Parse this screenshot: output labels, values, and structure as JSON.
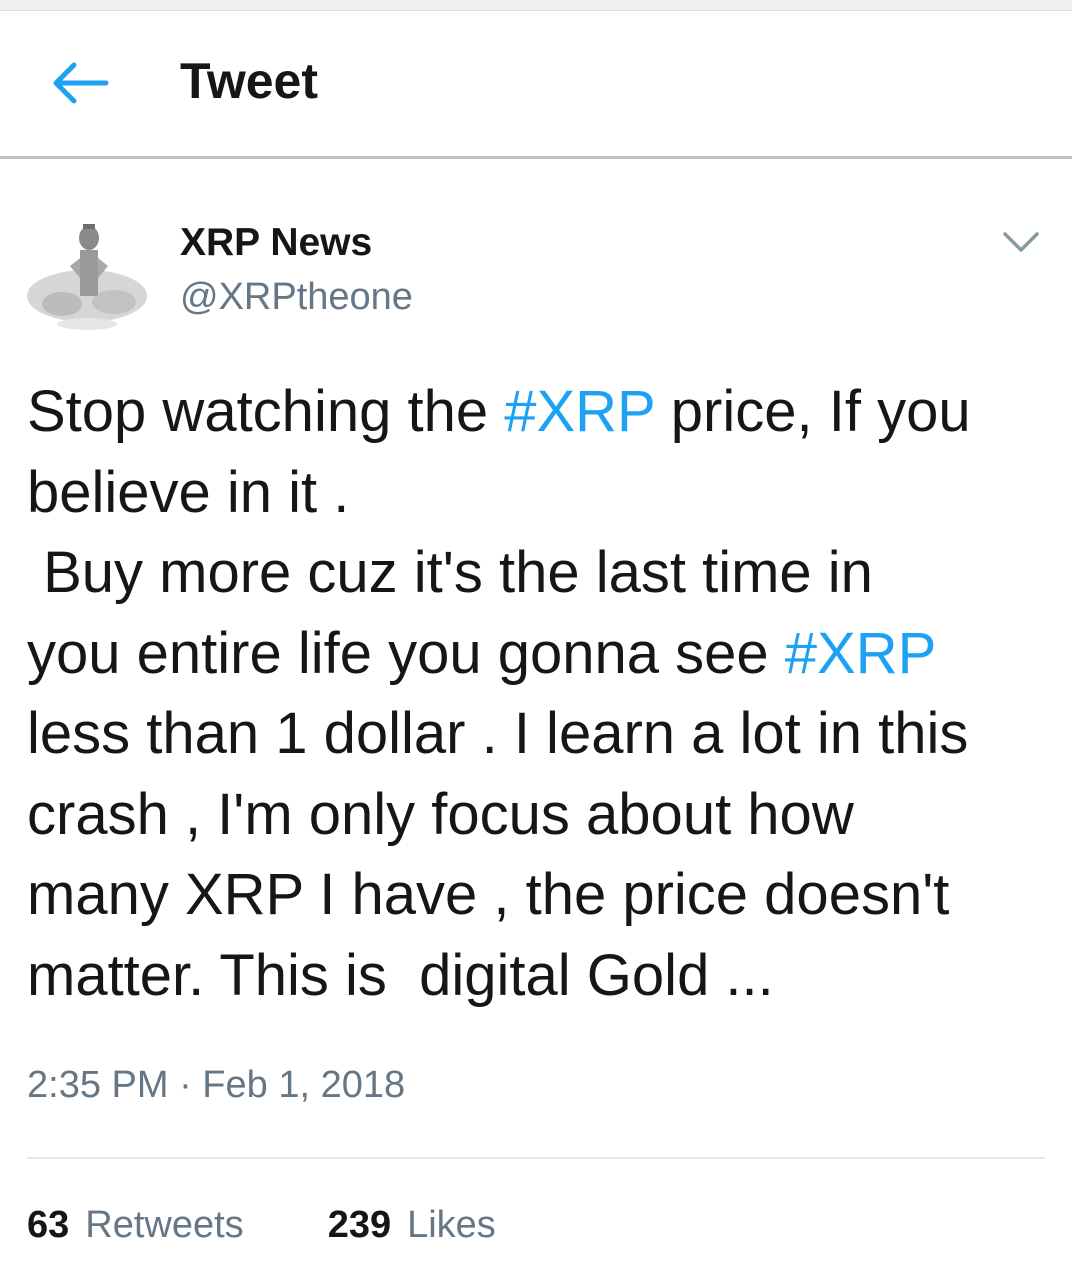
{
  "header": {
    "title": "Tweet",
    "back_icon": "arrow-left-icon",
    "accent_color": "#1da1f2"
  },
  "author": {
    "name": "XRP News",
    "handle": "@XRPtheone",
    "avatar_icon": "avatar-photo",
    "menu_icon": "chevron-down-icon"
  },
  "tweet": {
    "lines": [
      [
        {
          "t": "Stop watching the "
        },
        {
          "t": "#XRP",
          "tag": true
        },
        {
          "t": " price, If you"
        }
      ],
      [
        {
          "t": "believe in it ."
        }
      ],
      [
        {
          "t": " Buy more cuz it's the last time in"
        }
      ],
      [
        {
          "t": "you entire life you gonna see "
        },
        {
          "t": "#XRP",
          "tag": true
        }
      ],
      [
        {
          "t": "less than 1 dollar . I learn a lot in this"
        }
      ],
      [
        {
          "t": "crash , I'm only focus about how"
        }
      ],
      [
        {
          "t": "many XRP I have , the price doesn't"
        }
      ],
      [
        {
          "t": "matter. This is  digital Gold ..."
        }
      ]
    ],
    "hashtag_color": "#1da1f2"
  },
  "timestamp": "2:35 PM · Feb 1, 2018",
  "stats": {
    "retweets": {
      "count": "63",
      "label": "Retweets"
    },
    "likes": {
      "count": "239",
      "label": "Likes"
    }
  }
}
